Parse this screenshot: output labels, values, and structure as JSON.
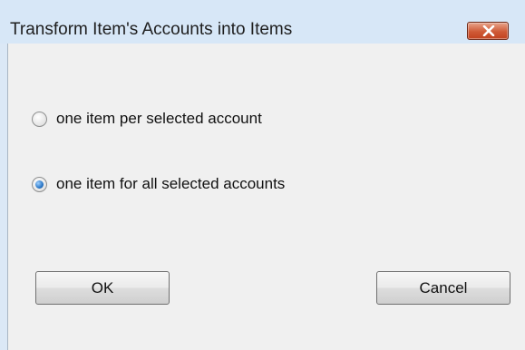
{
  "window": {
    "title": "Transform Item's Accounts into Items",
    "close_icon": "close-icon"
  },
  "options": {
    "per_account_label": "one item per selected account",
    "all_accounts_label": "one item for all selected accounts",
    "selected": "one item for all selected accounts"
  },
  "buttons": {
    "ok_label": "OK",
    "cancel_label": "Cancel"
  },
  "colors": {
    "titlebar": "#d7e7f7",
    "client": "#f0f0f0",
    "close_button": "#cf5a36"
  }
}
